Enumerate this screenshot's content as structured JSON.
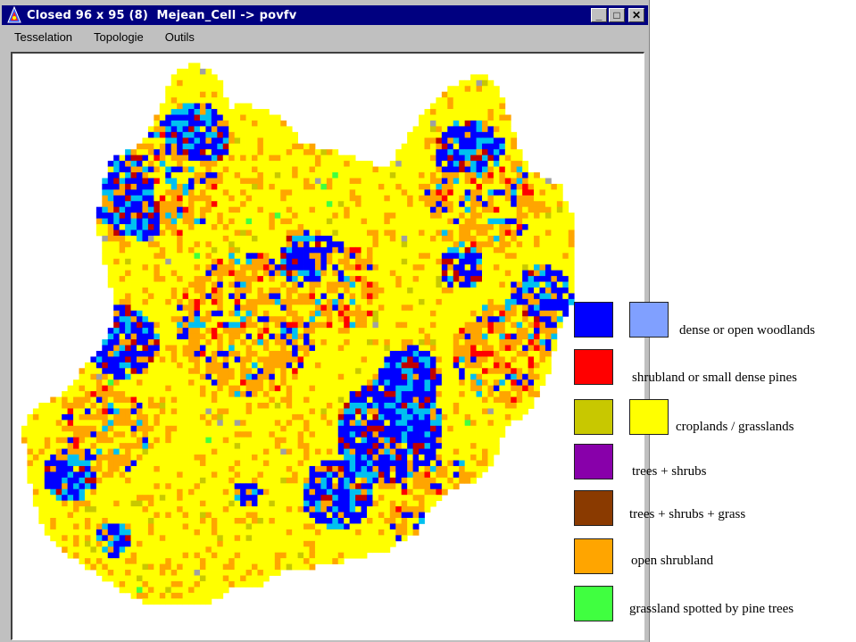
{
  "window": {
    "title": "Closed 96 x 95 (8)  Mejean_Cell -> povfv",
    "buttons": {
      "minimize": "_",
      "maximize": "□",
      "close": "✕"
    }
  },
  "menu": [
    "Tesselation",
    "Topologie",
    "Outils"
  ],
  "grid": {
    "cols": 96,
    "rows": 95
  },
  "map_colors": {
    "dense_wood": "#0000ff",
    "open_wood_cyan": "#00c0f0",
    "shrub_pine": "#ff0000",
    "dark_red": "#c00000",
    "crop": "#ffff00",
    "crop_dark": "#c8c800",
    "open_shrub": "#ffa500",
    "grass_pine": "#40ff40",
    "gray": "#a0a0a0"
  },
  "legend": [
    {
      "swatches": [
        "#0000ff",
        "#80a0ff"
      ],
      "label": "dense or open woodlands"
    },
    {
      "swatches": [
        "#ff0000"
      ],
      "label": "shrubland or small dense pines"
    },
    {
      "swatches": [
        "#c8c800",
        "#ffff00"
      ],
      "label": "croplands / grasslands"
    },
    {
      "swatches": [
        "#8800aa"
      ],
      "label": "trees + shrubs"
    },
    {
      "swatches": [
        "#8a3a00"
      ],
      "label": "trees +  shrubs + grass"
    },
    {
      "swatches": [
        "#ffa500"
      ],
      "label": "open shrubland"
    },
    {
      "swatches": [
        "#40ff40"
      ],
      "label": "grassland spotted by pine trees"
    }
  ]
}
